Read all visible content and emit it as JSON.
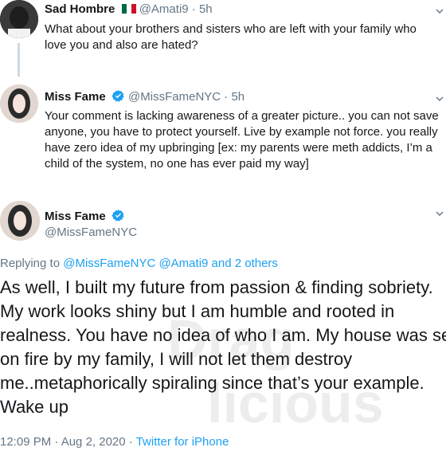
{
  "replies": [
    {
      "name": "Sad Hombre",
      "handle": "@Amati9",
      "time": "5h",
      "text_lines": [
        "What about your brothers and sisters who are left with your family who",
        "love you and also are hated?"
      ],
      "flag_icon": "mexico-flag-icon"
    },
    {
      "name": "Miss Fame",
      "handle": "@MissFameNYC",
      "time": "5h",
      "text_lines": [
        "Your comment is lacking awareness of a greater picture.. you can not save",
        "anyone, you have to protect yourself. Live by example not force. you really",
        "have zero idea of my upbringing [ex: my parents were meth addicts, I’m a",
        "child of the system, no one has ever paid my way]"
      ]
    }
  ],
  "main": {
    "name": "Miss Fame",
    "handle": "@MissFameNYC",
    "replying_prefix": "Replying to",
    "replying_handles": "@MissFameNYC @Amati9 and 2 others",
    "text_lines": [
      "As well, I built my future from passion & finding sobriety.",
      "My work looks shiny but I am humble and rooted in",
      "realness. You have no idea of who I am. My house was set",
      "on fire by my family, I will not let them destroy",
      "me..metaphorically spiraling since that’s your example.",
      "Wake up"
    ],
    "timestamp": "12:09 PM · Aug 2, 2020",
    "separator": "·",
    "source": "Twitter for iPhone"
  },
  "watermark_text": "DragQlicious",
  "colors": {
    "verified": "#1da1f2",
    "link": "#1da1f2",
    "muted": "#657786"
  }
}
